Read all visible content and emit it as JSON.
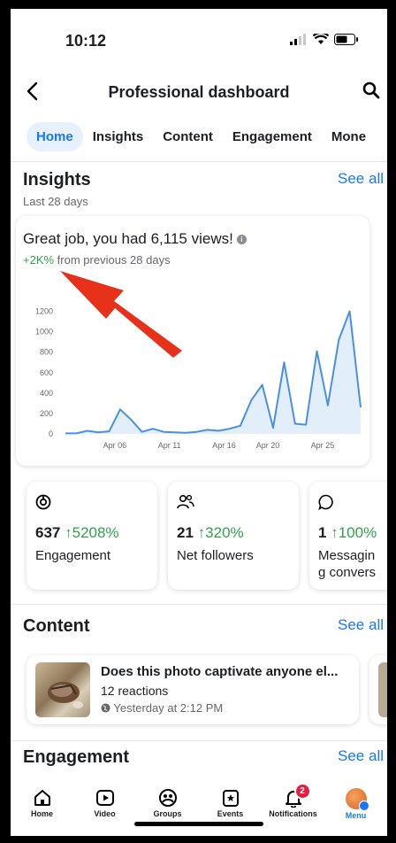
{
  "status": {
    "time": "10:12"
  },
  "header": {
    "title": "Professional dashboard"
  },
  "tabs": [
    {
      "label": "Home",
      "active": true
    },
    {
      "label": "Insights"
    },
    {
      "label": "Content"
    },
    {
      "label": "Engagement"
    },
    {
      "label": "Mone"
    }
  ],
  "insights": {
    "title": "Insights",
    "see_all": "See all",
    "period": "Last 28 days",
    "card": {
      "headline": "Great job, you had 6,115 views!",
      "change_value": "+2K%",
      "change_text": " from previous 28 days"
    }
  },
  "chart_data": {
    "type": "area",
    "y_ticks": [
      "1200",
      "1000",
      "800",
      "600",
      "400",
      "200",
      "0"
    ],
    "x_ticks": [
      "Apr 06",
      "Apr 11",
      "Apr 16",
      "Apr 20",
      "Apr 25"
    ],
    "ylim": [
      0,
      1300
    ],
    "values": [
      5,
      5,
      30,
      15,
      25,
      240,
      140,
      20,
      50,
      20,
      15,
      10,
      20,
      40,
      30,
      50,
      80,
      330,
      480,
      60,
      700,
      100,
      90,
      810,
      280,
      920,
      1200,
      260
    ],
    "color": "#4a90e2",
    "fill": "#e3eefb"
  },
  "metrics": [
    {
      "icon": "engagement-icon",
      "value": "637",
      "change": "↑5208%",
      "label": "Engagement"
    },
    {
      "icon": "followers-icon",
      "value": "21",
      "change": "↑320%",
      "label": "Net followers"
    },
    {
      "icon": "messaging-icon",
      "value": "1",
      "change": "↑100%",
      "label": "Messaging conversatio"
    }
  ],
  "content": {
    "title": "Content",
    "see_all": "See all",
    "post": {
      "title": "Does this photo captivate anyone el...",
      "reactions": "12 reactions",
      "time": "Yesterday at 2:12 PM"
    }
  },
  "engagement": {
    "title": "Engagement",
    "see_all": "See all"
  },
  "bottom_nav": [
    {
      "label": "Home",
      "icon": "home-icon"
    },
    {
      "label": "Video",
      "icon": "video-icon"
    },
    {
      "label": "Groups",
      "icon": "groups-icon"
    },
    {
      "label": "Events",
      "icon": "events-icon"
    },
    {
      "label": "Notifications",
      "icon": "bell-icon",
      "badge": "2"
    },
    {
      "label": "Menu",
      "icon": "avatar",
      "active": true
    }
  ],
  "accent_color": "#1877f2",
  "annotation": {
    "arrow_color": "#e8311b"
  }
}
